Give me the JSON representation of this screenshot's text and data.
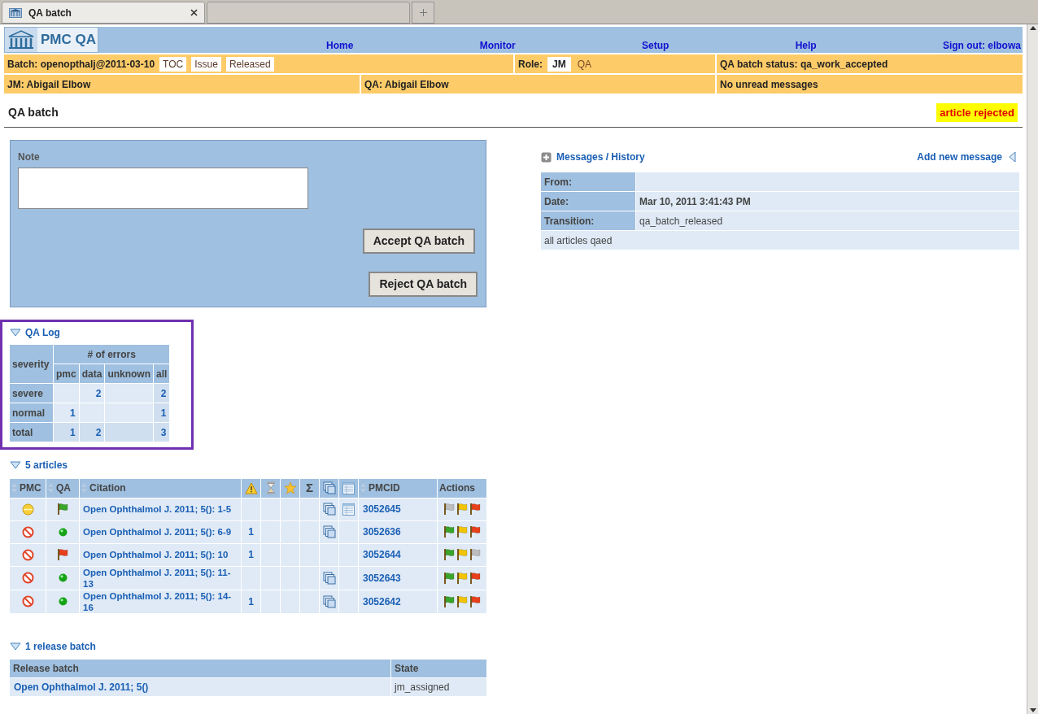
{
  "browser": {
    "tabs": [
      {
        "title": "QA batch",
        "selected": true
      },
      {
        "selected": false
      }
    ]
  },
  "header": {
    "logo": "PMC QA",
    "nav": [
      "Home",
      "Monitor",
      "Setup",
      "Help",
      "Sign out: elbowa"
    ]
  },
  "batch_bar": {
    "batch": "Batch: openopthalj@2011-03-10",
    "tags": [
      "TOC",
      "Issue",
      "Released"
    ],
    "role_label": "Role:",
    "roles": [
      {
        "label": "JM",
        "selected": true
      },
      {
        "label": "QA",
        "selected": false
      }
    ],
    "status": "QA batch status: qa_work_accepted",
    "jm": "JM: Abigail Elbow",
    "qa": "QA: Abigail Elbow",
    "messages": "No unread messages"
  },
  "page_title": "QA batch",
  "badge": "article rejected",
  "note": {
    "label": "Note",
    "buttons": [
      "Accept QA batch",
      "Reject QA batch"
    ]
  },
  "messages": {
    "title": "Messages / History",
    "expanded": false,
    "add": "Add new message",
    "rows": [
      {
        "label": "From:"
      },
      {
        "label": "Date:",
        "value": "Mar 10, 2011 3:41:43 PM",
        "bold": true
      },
      {
        "label": "Transition:",
        "value": "qa_batch_released",
        "bold": false
      }
    ],
    "body": "all articles qaed"
  },
  "qa_log": {
    "title": "QA Log",
    "expanded": true,
    "corner": "severity",
    "group": "# of errors",
    "columns": [
      "pmc",
      "data",
      "unknown",
      "all"
    ],
    "rows": [
      {
        "label": "severe",
        "cells": [
          {
            "kind": "blank"
          },
          {
            "kind": "count",
            "value": "2"
          },
          {
            "kind": "blank"
          },
          {
            "kind": "count",
            "value": "2"
          }
        ]
      },
      {
        "label": "normal",
        "cells": [
          {
            "kind": "count",
            "value": "1"
          },
          {
            "kind": "blank"
          },
          {
            "kind": "blank"
          },
          {
            "kind": "count",
            "value": "1"
          }
        ]
      },
      {
        "label": "total",
        "cells": [
          {
            "kind": "count",
            "value": "1"
          },
          {
            "kind": "count",
            "value": "2"
          },
          {
            "kind": "blank"
          },
          {
            "kind": "count",
            "value": "3"
          }
        ]
      }
    ]
  },
  "articles": {
    "title": "5 articles",
    "expanded": true,
    "columns": [
      {
        "kind": "sortable",
        "label": "PMC"
      },
      {
        "kind": "sortable",
        "label": "QA"
      },
      {
        "kind": "sortable",
        "label": "Citation"
      },
      {
        "kind": "warning"
      },
      {
        "kind": "hourglass"
      },
      {
        "kind": "star"
      },
      {
        "kind": "plain",
        "label": "Σ"
      },
      {
        "kind": "copies"
      },
      {
        "kind": "table"
      },
      {
        "kind": "sortable",
        "label": "PMCID"
      },
      {
        "kind": "plain",
        "label": "Actions"
      }
    ],
    "rows": [
      {
        "pmc_status": {
          "kind": "neutral"
        },
        "qa_status": {
          "kind": "flag-green"
        },
        "citation": "Open Ophthalmol J. 2011; 5(): 1-5",
        "copies": true,
        "table": true,
        "pmcid": "3052645",
        "actions": [
          {
            "color": "#bdbdbd"
          },
          {
            "color": "#f2c400"
          },
          {
            "color": "#e8401c"
          }
        ]
      },
      {
        "pmc_status": {
          "kind": "rejected"
        },
        "qa_status": {
          "kind": "dot-green"
        },
        "citation": "Open Ophthalmol J. 2011; 5(): 6-9",
        "warnings": "1",
        "copies": true,
        "table": false,
        "pmcid": "3052636",
        "actions": [
          {
            "color": "#3aa52a"
          },
          {
            "color": "#f2c400"
          },
          {
            "color": "#e8401c"
          }
        ]
      },
      {
        "pmc_status": {
          "kind": "rejected"
        },
        "qa_status": {
          "kind": "flag-red"
        },
        "citation": "Open Ophthalmol J. 2011; 5(): 10",
        "warnings": "1",
        "copies": false,
        "table": false,
        "pmcid": "3052644",
        "actions": [
          {
            "color": "#3aa52a"
          },
          {
            "color": "#f2c400"
          },
          {
            "color": "#bdbdbd"
          }
        ]
      },
      {
        "pmc_status": {
          "kind": "rejected"
        },
        "qa_status": {
          "kind": "dot-green"
        },
        "citation": "Open Ophthalmol J. 2011; 5(): 11-13",
        "copies": true,
        "table": false,
        "pmcid": "3052643",
        "actions": [
          {
            "color": "#3aa52a"
          },
          {
            "color": "#f2c400"
          },
          {
            "color": "#e8401c"
          }
        ]
      },
      {
        "pmc_status": {
          "kind": "rejected"
        },
        "qa_status": {
          "kind": "dot-green"
        },
        "citation": "Open Ophthalmol J. 2011; 5(): 14-16",
        "warnings": "1",
        "copies": true,
        "table": false,
        "pmcid": "3052642",
        "actions": [
          {
            "color": "#3aa52a"
          },
          {
            "color": "#f2c400"
          },
          {
            "color": "#e8401c"
          }
        ]
      }
    ]
  },
  "release": {
    "title": "1 release batch",
    "expanded": true,
    "columns": [
      "Release batch",
      "State"
    ],
    "rows": [
      {
        "batch": "Open Ophthalmol J. 2011; 5()",
        "state": "jm_assigned"
      }
    ]
  }
}
